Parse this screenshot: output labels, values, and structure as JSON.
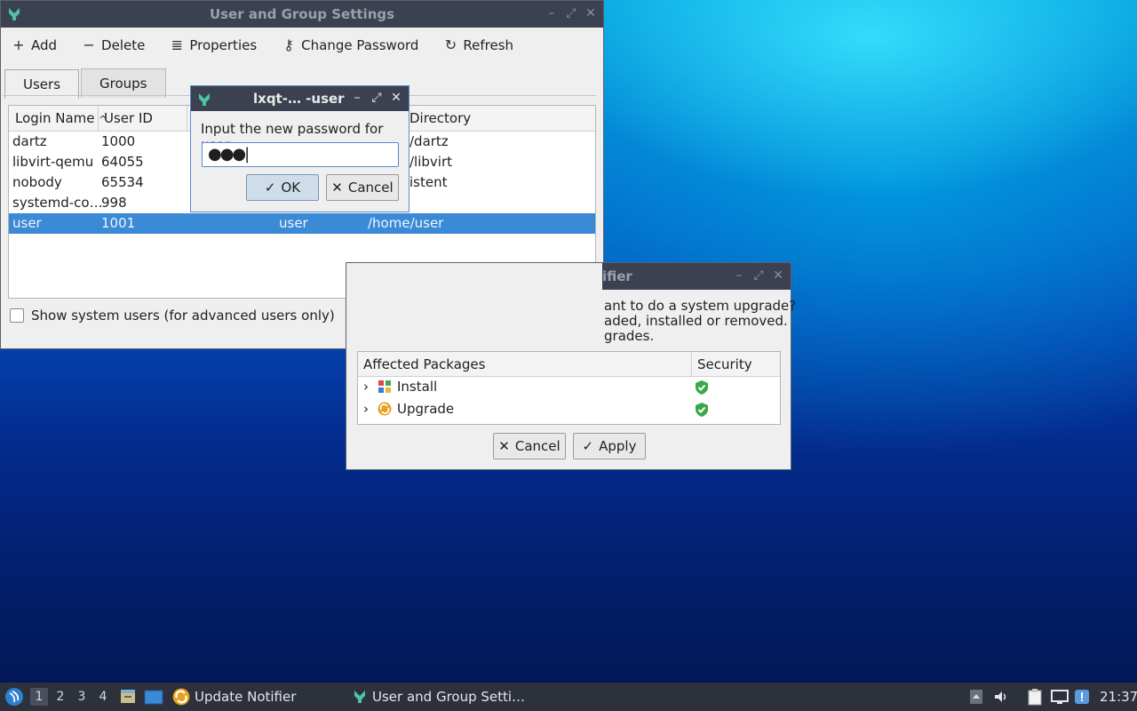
{
  "user_group_window": {
    "title": "User and Group Settings",
    "toolbar": [
      {
        "icon": "plus-icon",
        "label": "Add"
      },
      {
        "icon": "minus-icon",
        "label": "Delete"
      },
      {
        "icon": "list-icon",
        "label": "Properties"
      },
      {
        "icon": "key-icon",
        "label": "Change Password"
      },
      {
        "icon": "refresh-icon",
        "label": "Refresh"
      }
    ],
    "tabs": [
      "Users",
      "Groups"
    ],
    "columns": [
      "Login Name",
      "User ID",
      "Directory"
    ],
    "rows": [
      {
        "login": "dartz",
        "uid": "1000",
        "group": "",
        "dir": "/dartz"
      },
      {
        "login": "libvirt-qemu",
        "uid": "64055",
        "group": "",
        "dir": "/libvirt"
      },
      {
        "login": "nobody",
        "uid": "65534",
        "group": "",
        "dir": "istent"
      },
      {
        "login": "systemd-co…",
        "uid": "998",
        "group": "",
        "dir": ""
      },
      {
        "login": "user",
        "uid": "1001",
        "group": "user",
        "dir": "/home/user"
      }
    ],
    "show_system_users": "Show system users (for advanced users only)"
  },
  "password_dialog": {
    "title": "lxqt-…  -user",
    "label": "Input the new password for user:",
    "value": "●●●",
    "ok": "OK",
    "cancel": "Cancel"
  },
  "update_notifier": {
    "title": "ifier",
    "line1": "ant to do a system upgrade?",
    "line2": "aded, installed or removed.",
    "line3": "grades.",
    "col_packages": "Affected Packages",
    "col_security": "Security",
    "items": [
      "Install",
      "Upgrade"
    ],
    "cancel": "Cancel",
    "apply": "Apply"
  },
  "taskbar": {
    "workspaces": [
      "1",
      "2",
      "3",
      "4"
    ],
    "tasks": [
      "Update Notifier",
      "User and Group Setti…"
    ],
    "clock": "21:37"
  },
  "colors": {
    "selection": "#3b8ad6",
    "titlebar": "#3b4150",
    "panel": "#2d313b"
  }
}
